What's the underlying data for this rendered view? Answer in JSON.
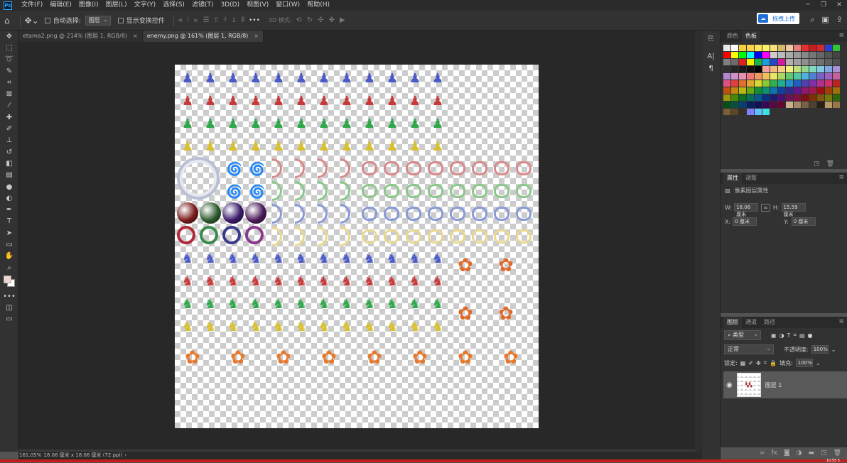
{
  "app": {
    "logo": "Ps"
  },
  "menu": [
    "文件(F)",
    "编辑(E)",
    "图像(I)",
    "图层(L)",
    "文字(Y)",
    "选择(S)",
    "滤镜(T)",
    "3D(D)",
    "视图(V)",
    "窗口(W)",
    "帮助(H)"
  ],
  "window_controls": [
    "─",
    "❐",
    "✕"
  ],
  "options": {
    "auto_select_label": "自动选择:",
    "auto_select_value": "图层",
    "show_transform_label": "显示变换控件",
    "mode_3d_label": "3D 模式:",
    "upload_label": "拖拽上传",
    "more_icon": "•••"
  },
  "tabs": [
    {
      "title": "etama2.png @ 214% (图层 1, RGB/8)",
      "close": "×",
      "active": false
    },
    {
      "title": "enemy.png @ 161% (图层 1, RGB/8)",
      "close": "×",
      "active": true
    }
  ],
  "tools": [
    {
      "name": "move-tool-icon",
      "glyph": "✥"
    },
    {
      "name": "marquee-tool-icon",
      "glyph": "⬚"
    },
    {
      "name": "lasso-tool-icon",
      "glyph": "➰"
    },
    {
      "name": "quick-select-icon",
      "glyph": "✎"
    },
    {
      "name": "crop-tool-icon",
      "glyph": "⌗"
    },
    {
      "name": "frame-tool-icon",
      "glyph": "⊠"
    },
    {
      "name": "eyedropper-icon",
      "glyph": "⁄"
    },
    {
      "name": "healing-brush-icon",
      "glyph": "✚"
    },
    {
      "name": "brush-tool-icon",
      "glyph": "✐"
    },
    {
      "name": "stamp-tool-icon",
      "glyph": "⊥"
    },
    {
      "name": "history-brush-icon",
      "glyph": "↺"
    },
    {
      "name": "eraser-icon",
      "glyph": "◧"
    },
    {
      "name": "gradient-tool-icon",
      "glyph": "▤"
    },
    {
      "name": "blur-tool-icon",
      "glyph": "●"
    },
    {
      "name": "dodge-tool-icon",
      "glyph": "◐"
    },
    {
      "name": "pen-tool-icon",
      "glyph": "✒"
    },
    {
      "name": "type-tool-icon",
      "glyph": "T"
    },
    {
      "name": "path-select-icon",
      "glyph": "➤"
    },
    {
      "name": "shape-tool-icon",
      "glyph": "▭"
    },
    {
      "name": "hand-tool-icon",
      "glyph": "✋"
    },
    {
      "name": "zoom-tool-icon",
      "glyph": "⌕"
    },
    {
      "name": "more-tools-icon",
      "glyph": "•••"
    }
  ],
  "colors": {
    "accent": "#31a8ff",
    "foreground": "#f0d4d4",
    "background": "#ffffff",
    "layer_selected": "#595959"
  },
  "swatches_panel": {
    "tab_color": "颜色",
    "tab_swatches": "色板"
  },
  "swatches": [
    "#e8e8e8",
    "#ffffff",
    "#f4d03f",
    "#ffd24a",
    "#ffe55c",
    "#fff06b",
    "#f7e27a",
    "#d4b96e",
    "#f0c7a2",
    "#e28080",
    "#e83030",
    "#c41e1e",
    "#d42a2a",
    "#2b3fd6",
    "#2ec43a",
    "#ff0000",
    "#ffff00",
    "#00ff00",
    "#00ffff",
    "#0000ff",
    "#ff00ff",
    "#cccccc",
    "#bbbbbb",
    "#aaaaaa",
    "#999999",
    "#888888",
    "#777777",
    "#666666",
    "#555555",
    "#444444",
    "#808080",
    "#6b6b6b",
    "#e02020",
    "#f5f000",
    "#1fb04a",
    "#1aa0d8",
    "#2448c8",
    "#d8189a",
    "#b0b0b0",
    "#a0a0a0",
    "#909090",
    "#808080",
    "#707070",
    "#606060",
    "#505050",
    "#303030",
    "#252525",
    "#1a1a1a",
    "#101010",
    "#000000",
    "#f5a0a0",
    "#f5b880",
    "#f5d080",
    "#f0f080",
    "#c0e080",
    "#90d890",
    "#80d8c0",
    "#80c8e8",
    "#80a8e0",
    "#a890d8",
    "#b088d0",
    "#d090c8",
    "#e890b0",
    "#f07878",
    "#f09860",
    "#f0c060",
    "#e8e860",
    "#a8d860",
    "#60c870",
    "#50c8a8",
    "#50b0e0",
    "#5080d0",
    "#7860c8",
    "#a060c0",
    "#c860a0",
    "#e05080",
    "#e04040",
    "#e07030",
    "#e0a830",
    "#d8d830",
    "#88c830",
    "#30b050",
    "#20b090",
    "#2090d0",
    "#2060c0",
    "#5040b0",
    "#8030a8",
    "#b03090",
    "#d03070",
    "#c02020",
    "#c05010",
    "#c08810",
    "#b8b810",
    "#68a810",
    "#109030",
    "#109070",
    "#1070b0",
    "#1040a0",
    "#302890",
    "#601890",
    "#901870",
    "#a01850",
    "#a01010",
    "#a04008",
    "#a07008",
    "#989808",
    "#488808",
    "#087020",
    "#087058",
    "#085890",
    "#083080",
    "#201870",
    "#481070",
    "#701058",
    "#801040",
    "#801010",
    "#803008",
    "#805808",
    "#787808",
    "#306808",
    "#065018",
    "#065040",
    "#064070",
    "#062060",
    "#141058",
    "#380858",
    "#580840",
    "#600830",
    "#c8b08c",
    "#a08868",
    "#786048",
    "#504030",
    "#282018",
    "#b89868",
    "#987848",
    "#786038",
    "#584828",
    "#3a3020",
    "#8080ff",
    "#60c0ff",
    "#40e0e0"
  ],
  "properties_panel": {
    "tab_props": "属性",
    "tab_adjust": "调整",
    "section": "像素图层属性",
    "w_label": "W:",
    "w_value": "18.06 厘米",
    "h_label": "H:",
    "h_value": "15.59 厘米",
    "x_label": "X:",
    "x_value": "0 厘米",
    "y_label": "Y:",
    "y_value": "0 厘米",
    "link_icon": "∞"
  },
  "layers_panel": {
    "tab_layers": "图层",
    "tab_channels": "通道",
    "tab_paths": "路径",
    "filter_kind": "类型",
    "blend_mode": "正常",
    "opacity_label": "不透明度:",
    "opacity_value": "100%",
    "lock_label": "锁定:",
    "fill_label": "填充:",
    "fill_value": "100%",
    "layer_name": "图层 1"
  },
  "status": {
    "zoom": "161.05%",
    "doc_size": "18.06 厘米 x 18.06 厘米 (72 ppi)"
  },
  "clock": "10:55 5"
}
